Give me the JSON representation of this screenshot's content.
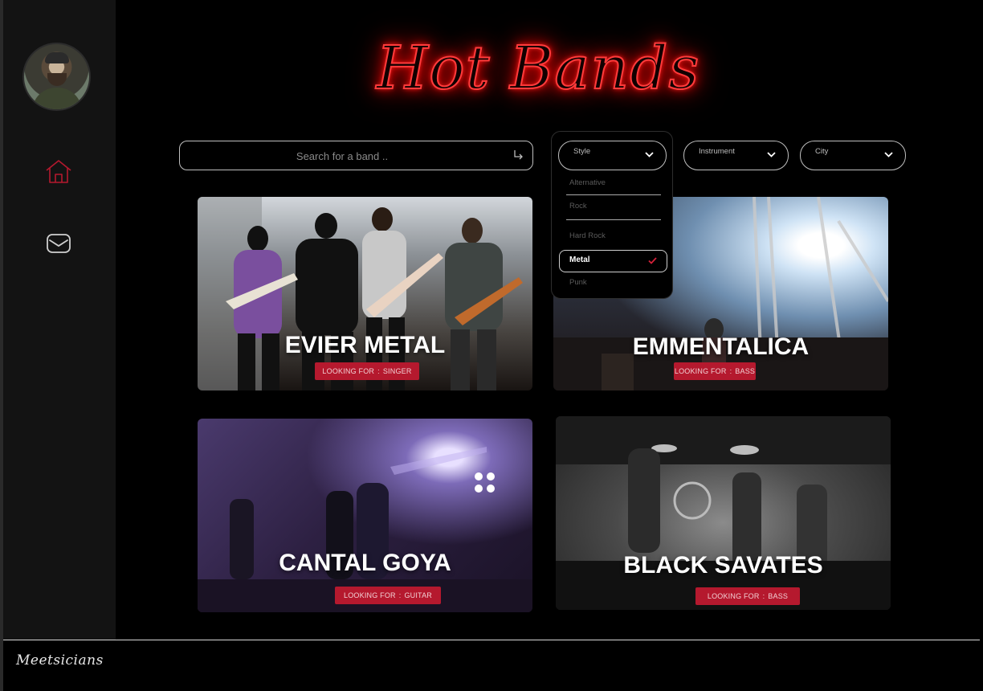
{
  "app": {
    "title": "Hot Bands",
    "footer_logo": "Meetsicians"
  },
  "sidebar": {
    "items": [
      {
        "icon": "home-icon",
        "active": true
      },
      {
        "icon": "mail-icon",
        "active": false
      }
    ]
  },
  "search": {
    "placeholder": "Search for a band ..",
    "value": ""
  },
  "filters": {
    "style": {
      "label": "Style",
      "open": true,
      "options": [
        "Alternative",
        "Rock",
        "Hard Rock",
        "Metal",
        "Punk"
      ],
      "selected": "Metal"
    },
    "instrument": {
      "label": "Instrument"
    },
    "city": {
      "label": "City"
    }
  },
  "bands": [
    {
      "name": "EVIER METAL",
      "looking_prefix": "LOOKING FOR",
      "sep": ":",
      "role": "SINGER"
    },
    {
      "name": "EMMENTALICA",
      "looking_prefix": "LOOKING FOR",
      "sep": ":",
      "role": "BASS"
    },
    {
      "name": "CANTAL GOYA",
      "looking_prefix": "LOOKING FOR",
      "sep": ":",
      "role": "GUITAR"
    },
    {
      "name": "BLACK SAVATES",
      "looking_prefix": "LOOKING FOR",
      "sep": ":",
      "role": "BASS"
    }
  ],
  "colors": {
    "accent": "#b5192e",
    "neon": "#ff1e1e",
    "background": "#000000",
    "sidebar": "#131313"
  }
}
